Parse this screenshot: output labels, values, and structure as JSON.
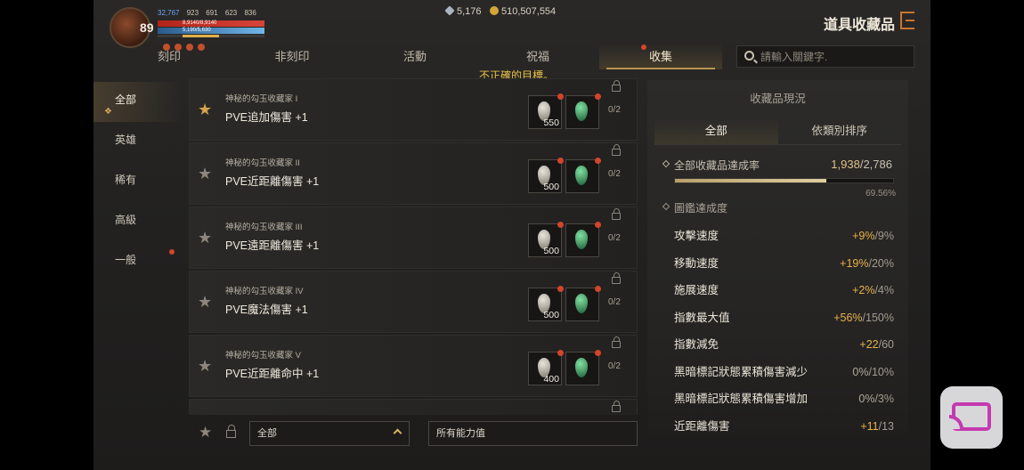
{
  "hud": {
    "level": "89",
    "stat1": "32,767",
    "stat2": "923",
    "stat3": "691",
    "stat4": "623",
    "stat5": "836",
    "hp": "8,9140/8,9140",
    "mp": "5,190/5,630"
  },
  "currency": {
    "gems": "5,176",
    "gold": "510,507,554"
  },
  "header": {
    "title": "道具收藏品"
  },
  "tabs": [
    {
      "label": "刻印"
    },
    {
      "label": "非刻印"
    },
    {
      "label": "活動"
    },
    {
      "label": "祝福"
    },
    {
      "label": "收集"
    }
  ],
  "search": {
    "placeholder": "請輸入關鍵字."
  },
  "warning": "不正確的目標。",
  "sidebar": {
    "items": [
      {
        "label": "全部"
      },
      {
        "label": "英雄"
      },
      {
        "label": "稀有"
      },
      {
        "label": "高級"
      },
      {
        "label": "一般"
      }
    ]
  },
  "collections": [
    {
      "name": "神秘的勾玉收藏家 I",
      "effect": "PVE追加傷害 +1",
      "qty": "550",
      "progress": "0/2"
    },
    {
      "name": "神秘的勾玉收藏家 II",
      "effect": "PVE近距離傷害 +1",
      "qty": "500",
      "progress": "0/2"
    },
    {
      "name": "神秘的勾玉收藏家 III",
      "effect": "PVE遠距離傷害 +1",
      "qty": "500",
      "progress": "0/2"
    },
    {
      "name": "神秘的勾玉收藏家 IV",
      "effect": "PVE魔法傷害 +1",
      "qty": "500",
      "progress": "0/2"
    },
    {
      "name": "神秘的勾玉收藏家 V",
      "effect": "PVE近距離命中 +1",
      "qty": "400",
      "progress": "0/2"
    }
  ],
  "filters": {
    "grade": "全部",
    "ability": "所有能力值"
  },
  "panel": {
    "title": "收藏品現況",
    "tabs": [
      {
        "label": "全部"
      },
      {
        "label": "依類別排序"
      }
    ],
    "achievement_label": "全部收藏品達成率",
    "achievement_done": "1,938",
    "achievement_total": "/2,786",
    "achievement_fraction": 0.6956,
    "achievement_pct": "69.56%",
    "codex_label": "圖鑑達成度",
    "stats": [
      {
        "name": "攻擊速度",
        "val": "+9%",
        "max": "/9%"
      },
      {
        "name": "移動速度",
        "val": "+19%",
        "max": "/20%"
      },
      {
        "name": "施展速度",
        "val": "+2%",
        "max": "/4%"
      },
      {
        "name": "指數最大值",
        "val": "+56%",
        "max": "/150%"
      },
      {
        "name": "指數減免",
        "val": "+22",
        "max": "/60"
      },
      {
        "name": "黑暗標記狀態累積傷害減少",
        "val": "0%",
        "max": "/10%"
      },
      {
        "name": "黑暗標記狀態累積傷害增加",
        "val": "0%",
        "max": "/3%"
      },
      {
        "name": "近距離傷害",
        "val": "+11",
        "max": "/13"
      }
    ]
  }
}
